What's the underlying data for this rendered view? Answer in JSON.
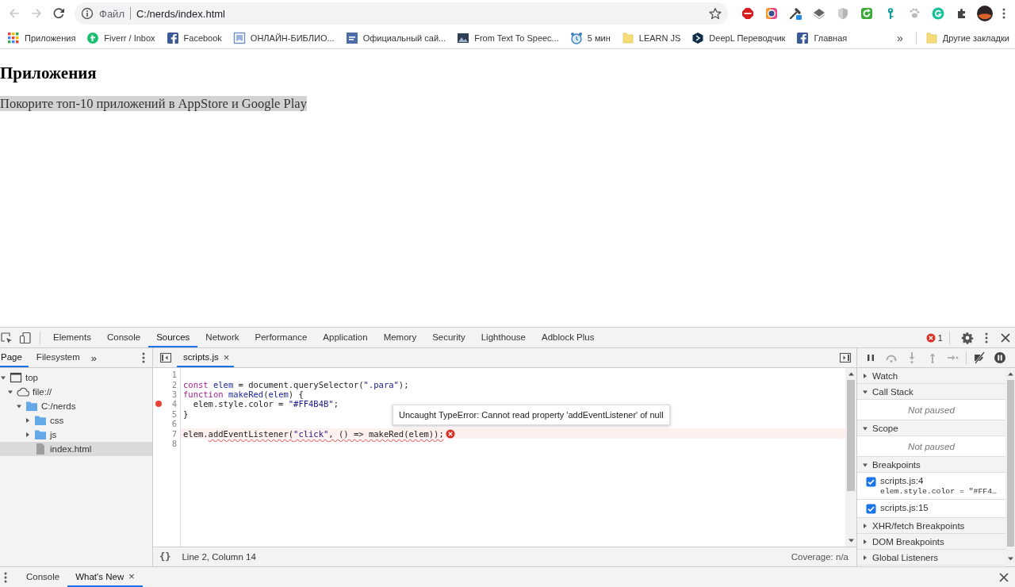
{
  "browser": {
    "address": {
      "scheme": "Файл",
      "url": "C:/nerds/index.html"
    },
    "bookmarks": [
      {
        "label": "Приложения"
      },
      {
        "label": "Fiverr / Inbox"
      },
      {
        "label": "Facebook"
      },
      {
        "label": "ОНЛАЙН-БИБЛИО..."
      },
      {
        "label": "Официальный сай..."
      },
      {
        "label": "From Text To Speec..."
      },
      {
        "label": "5 мин"
      },
      {
        "label": "LEARN JS"
      },
      {
        "label": "DeepL Переводчик"
      },
      {
        "label": "Главная"
      }
    ],
    "bookmarks_more": "»",
    "other_bookmarks": "Другие закладки"
  },
  "page": {
    "heading": "Приложения",
    "paragraph": "Покорите топ-10 приложений в AppStore и Google Play"
  },
  "devtools": {
    "tabs": [
      {
        "label": "Elements",
        "selected": false
      },
      {
        "label": "Console",
        "selected": false
      },
      {
        "label": "Sources",
        "selected": true
      },
      {
        "label": "Network",
        "selected": false
      },
      {
        "label": "Performance",
        "selected": false
      },
      {
        "label": "Application",
        "selected": false
      },
      {
        "label": "Memory",
        "selected": false
      },
      {
        "label": "Security",
        "selected": false
      },
      {
        "label": "Lighthouse",
        "selected": false
      },
      {
        "label": "Adblock Plus",
        "selected": false
      }
    ],
    "error_count": "1",
    "navigator": {
      "tabs": [
        {
          "label": "Page",
          "selected": true
        },
        {
          "label": "Filesystem",
          "selected": false
        }
      ],
      "more": "»",
      "tree": [
        {
          "label": "top",
          "kind": "frame",
          "expanded": true,
          "selected": false,
          "children": [
            {
              "label": "file://",
              "kind": "origin",
              "expanded": true,
              "selected": false,
              "children": [
                {
                  "label": "C:/nerds",
                  "kind": "folder",
                  "expanded": true,
                  "selected": false,
                  "children": [
                    {
                      "label": "css",
                      "kind": "folder",
                      "expanded": false,
                      "selected": false
                    },
                    {
                      "label": "js",
                      "kind": "folder",
                      "expanded": false,
                      "selected": false
                    },
                    {
                      "label": "index.html",
                      "kind": "file",
                      "selected": true
                    }
                  ]
                }
              ]
            }
          ]
        }
      ]
    },
    "editor": {
      "tabs": [
        {
          "label": "scripts.js",
          "selected": true,
          "close": "×"
        }
      ],
      "lines": [
        {
          "number": "1",
          "breakpoint": false,
          "error": false
        },
        {
          "number": "2",
          "breakpoint": false,
          "error": false,
          "tokens": [
            {
              "text": "const",
              "kind": "keyword"
            },
            {
              "text": " elem",
              "kind": "def"
            },
            {
              "text": " = document.querySelector("
            },
            {
              "text": "\".para\"",
              "kind": "string"
            },
            {
              "text": ");"
            }
          ]
        },
        {
          "number": "3",
          "breakpoint": false,
          "error": false,
          "tokens": [
            {
              "text": "function",
              "kind": "keyword"
            },
            {
              "text": " makeRed",
              "kind": "def"
            },
            {
              "text": "("
            },
            {
              "text": "elem",
              "kind": "def"
            },
            {
              "text": ") {"
            }
          ]
        },
        {
          "number": "4",
          "breakpoint": true,
          "error": false,
          "tokens": [
            {
              "text": "  elem.style.color = "
            },
            {
              "text": "\"#FF4B4B\"",
              "kind": "string"
            },
            {
              "text": ";"
            }
          ]
        },
        {
          "number": "5",
          "breakpoint": false,
          "error": false,
          "tokens": [
            {
              "text": "}"
            }
          ]
        },
        {
          "number": "6",
          "breakpoint": false,
          "error": false
        },
        {
          "number": "7",
          "breakpoint": false,
          "error": true,
          "tokens": [
            {
              "text": "elem."
            },
            {
              "text": "addEventListener(",
              "underline": true
            },
            {
              "text": "\"click\"",
              "kind": "string",
              "underline": true
            },
            {
              "text": ", () => makeRed(elem));",
              "underline": true
            }
          ]
        },
        {
          "number": "8",
          "breakpoint": false,
          "error": false
        }
      ],
      "tooltip": "Uncaught TypeError: Cannot read property 'addEventListener' of null",
      "format_button": "{}",
      "cursor": "Line 2, Column 14",
      "coverage": "Coverage: n/a"
    },
    "sidebar": {
      "sections": [
        {
          "title": "Watch",
          "expanded": false
        },
        {
          "title": "Call Stack",
          "expanded": true,
          "message": "Not paused"
        },
        {
          "title": "Scope",
          "expanded": true,
          "message": "Not paused"
        },
        {
          "title": "Breakpoints",
          "expanded": true,
          "breakpoints": [
            {
              "location": "scripts.js:4",
              "code": "elem.style.color = \"#FF4…",
              "checked": true
            },
            {
              "location": "scripts.js:15",
              "checked": true
            }
          ]
        },
        {
          "title": "XHR/fetch Breakpoints",
          "expanded": false
        },
        {
          "title": "DOM Breakpoints",
          "expanded": false
        },
        {
          "title": "Global Listeners",
          "expanded": false
        }
      ]
    },
    "drawer": {
      "tabs": [
        {
          "label": "Console",
          "selected": false
        },
        {
          "label": "What's New",
          "selected": true,
          "close": "×"
        }
      ]
    }
  }
}
